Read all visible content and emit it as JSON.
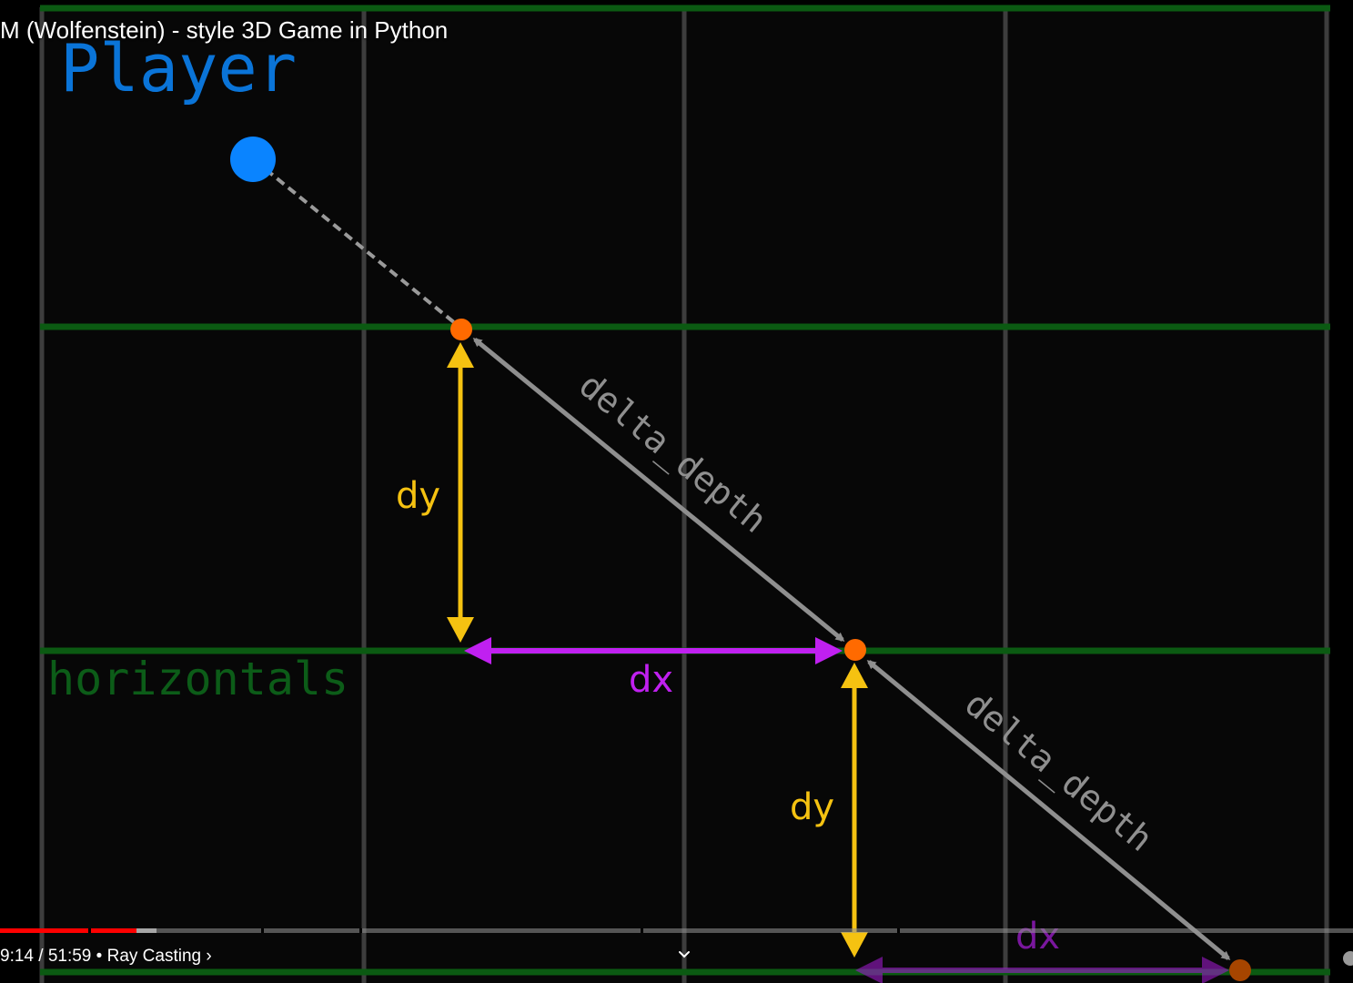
{
  "video": {
    "title": "M (Wolfenstein) - style 3D Game in Python",
    "current_time": "9:14",
    "separator": "/",
    "duration": "51:59",
    "bullet": "•",
    "chapter": "Ray Casting",
    "chapter_chevron": "›",
    "progress_fraction": 0.101,
    "buffered_fraction": 0.116
  },
  "diagram": {
    "player_label": "Player",
    "horizontals_label": "horizontals",
    "dy_label": "dy",
    "dx_label": "dx",
    "delta_depth_label": "delta_depth",
    "colors": {
      "player": "#0a84ff",
      "grid_horizontal": "#0b5a12",
      "grid_vertical": "#3d3d3d",
      "intersection": "#ff6a00",
      "dy_arrow": "#f5c211",
      "dx_arrow": "#c020f0",
      "depth_arrow": "#8f8f8f",
      "horizontals_text": "#0c5c18"
    }
  },
  "icons": {
    "chevron_down": "chevron-down-icon"
  }
}
